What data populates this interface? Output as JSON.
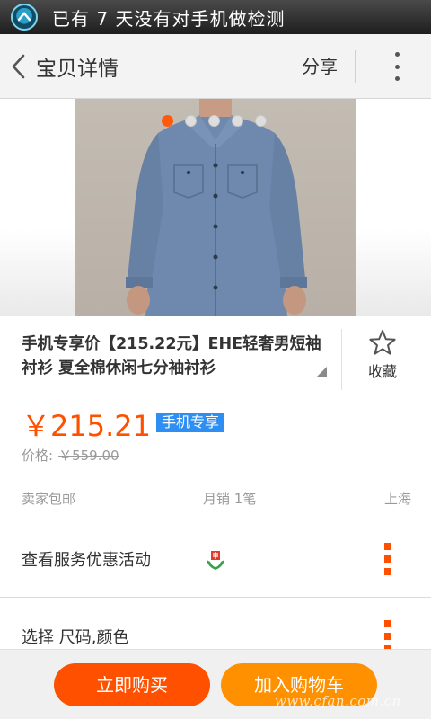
{
  "status_bar": {
    "message": "已有 7 天没有对手机做检测"
  },
  "header": {
    "title": "宝贝详情",
    "share_label": "分享"
  },
  "gallery": {
    "slide_count": 5,
    "active_slide": 1
  },
  "product": {
    "title": "手机专享价【215.22元】EHE轻奢男短袖衬衫 夏全棉休闲七分袖衬衫",
    "favorite_label": "收藏",
    "price": "￥215.21",
    "price_badge": "手机专享",
    "original_price_label": "价格:",
    "original_price": "￥559.00"
  },
  "meta": {
    "shipping": "卖家包邮",
    "monthly_sales": "月销 1笔",
    "location": "上海"
  },
  "rows": {
    "services_label": "查看服务优惠活动",
    "options_label": "选择 尺码,颜色"
  },
  "actions": {
    "buy_now": "立即购买",
    "add_to_cart": "加入购物车"
  },
  "watermark": "www.cfan.com.cn",
  "colors": {
    "accent_orange": "#ff5000",
    "cart_orange": "#ff9100",
    "badge_blue": "#2f8ef2",
    "shirt_blue": "#6e89ad"
  }
}
